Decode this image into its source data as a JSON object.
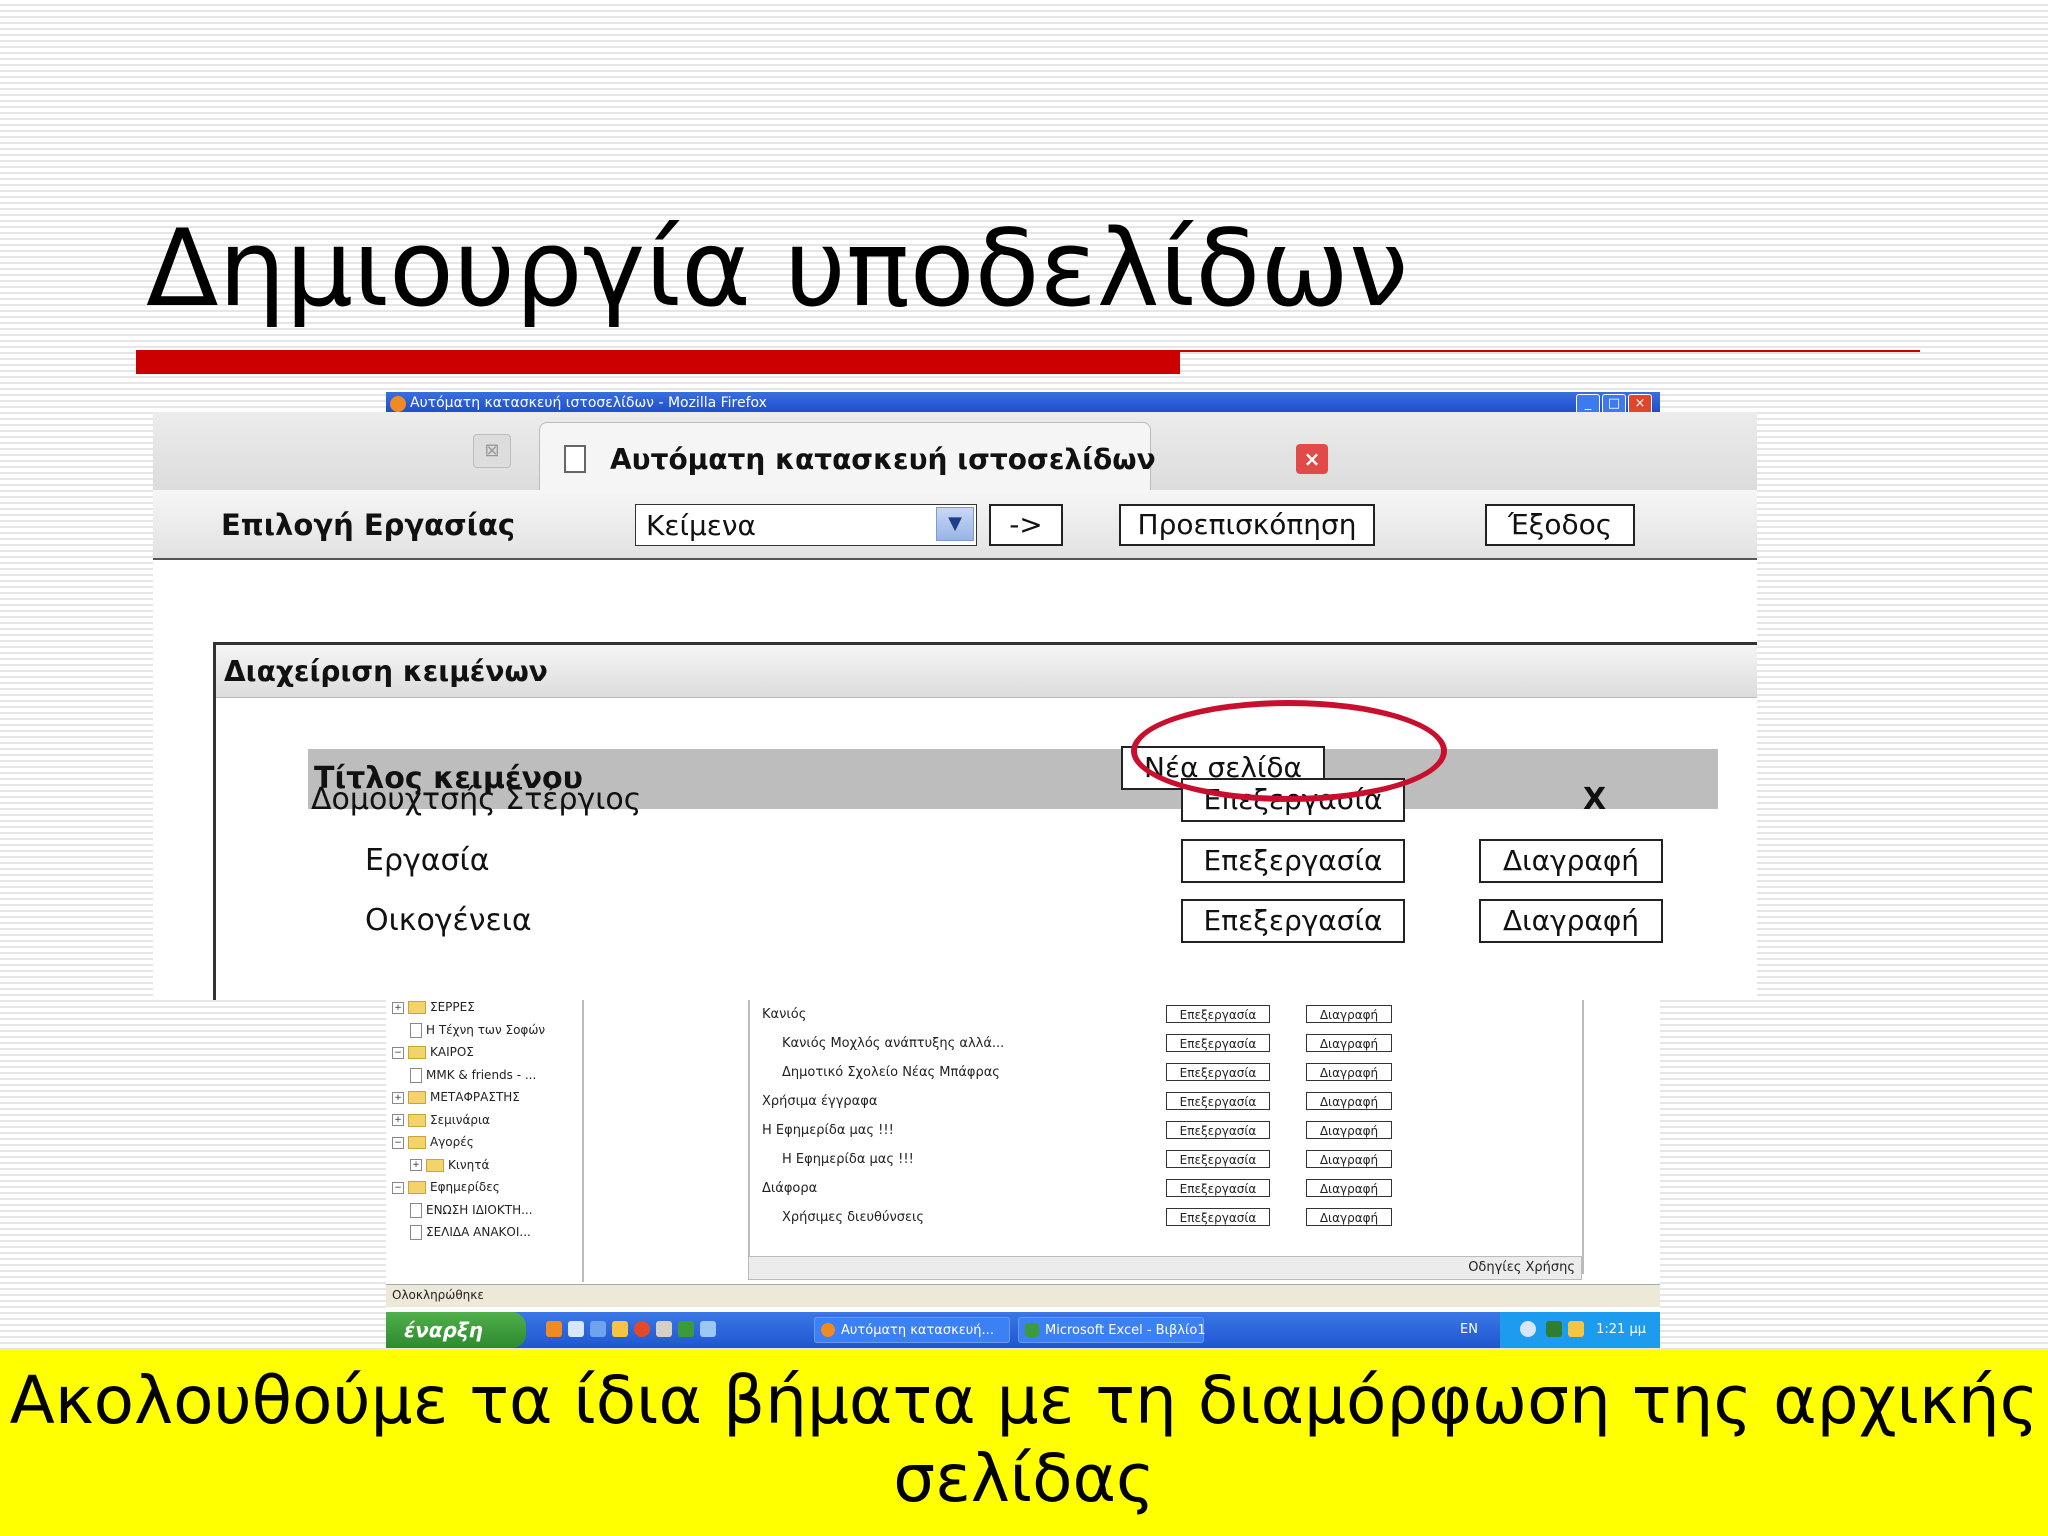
{
  "slide": {
    "title": "Δημιουργία υποδελίδων",
    "caption": "Ακολουθούμε τα ίδια βήματα με τη διαμόρφωση της αρχικής σελίδας",
    "accent_color": "#cc0000",
    "caption_background": "#ffff00"
  },
  "browser_window": {
    "title": "Αυτόματη κατασκευή ιστοσελίδων - Mozilla Firefox",
    "controls": [
      "_",
      "□",
      "×"
    ]
  },
  "tab": {
    "label": "Αυτόματη κατασκευή ιστοσελίδων",
    "close_icon": "close-icon"
  },
  "toolbar": {
    "task_label": "Επιλογή Εργασίας",
    "select_value": "Κείμενα",
    "go_label": "->",
    "preview_label": "Προεπισκόπηση",
    "exit_label": "Έξοδος"
  },
  "manage": {
    "header": "Διαχείριση κειμένων",
    "column_title": "Τίτλος κειμένου",
    "new_page_label": "Νέα σελίδα",
    "edit_label": "Επεξεργασία",
    "delete_label": "Διαγραφή",
    "x_label": "X",
    "rows": [
      {
        "title": "Δομουχτσής Στέργιος",
        "indent": 0
      },
      {
        "title": "Εργασία",
        "indent": 1
      },
      {
        "title": "Οικογένεια",
        "indent": 1
      }
    ]
  },
  "tree": {
    "items": [
      {
        "label": "ΣΕΡΡΕΣ",
        "level": 0,
        "type": "folder",
        "exp": "+"
      },
      {
        "label": "Η Τέχνη των Σοφών",
        "level": 1,
        "type": "page"
      },
      {
        "label": "ΚΑΙΡΟΣ",
        "level": 0,
        "type": "folder",
        "exp": "−"
      },
      {
        "label": "MMK & friends - ...",
        "level": 1,
        "type": "page"
      },
      {
        "label": "ΜΕΤΑΦΡΑΣΤΗΣ",
        "level": 0,
        "type": "folder",
        "exp": "+"
      },
      {
        "label": "Σεμινάρια",
        "level": 0,
        "type": "folder",
        "exp": "+"
      },
      {
        "label": "Αγορές",
        "level": 0,
        "type": "folder",
        "exp": "−"
      },
      {
        "label": "Κινητά",
        "level": 1,
        "type": "folder",
        "exp": "+"
      },
      {
        "label": "Εφημερίδες",
        "level": 0,
        "type": "folder",
        "exp": "−"
      },
      {
        "label": "ΕΝΩΣΗ ΙΔΙΟΚΤΗ...",
        "level": 1,
        "type": "page"
      },
      {
        "label": "ΣΕΛΙΔΑ ΑΝΑΚΟΙ...",
        "level": 1,
        "type": "page"
      }
    ]
  },
  "small_list": {
    "edit_label": "Επεξεργασία",
    "delete_label": "Διαγραφή",
    "rows": [
      {
        "title": "Κανιός",
        "indent": 0
      },
      {
        "title": "Κανιός Μοχλός ανάπτυξης αλλά...",
        "indent": 1
      },
      {
        "title": "Δημοτικό Σχολείο Νέας Μπάφρας",
        "indent": 1
      },
      {
        "title": "Χρήσιμα έγγραφα",
        "indent": 0
      },
      {
        "title": "Η Εφημερίδα μας !!!",
        "indent": 0
      },
      {
        "title": "Η Εφημερίδα μας !!!",
        "indent": 1
      },
      {
        "title": "Διάφορα",
        "indent": 0
      },
      {
        "title": "Χρήσιμες διευθύνσεις",
        "indent": 1
      }
    ],
    "help_text": "Οδηγίες Χρήσης"
  },
  "status_bar": {
    "text": "Ολοκληρώθηκε"
  },
  "taskbar": {
    "start_label": "έναρξη",
    "task_firefox": "Αυτόματη κατασκευή...",
    "task_excel": "Microsoft Excel - Βιβλίο1",
    "lang": "EN",
    "clock": "1:21 μμ"
  }
}
